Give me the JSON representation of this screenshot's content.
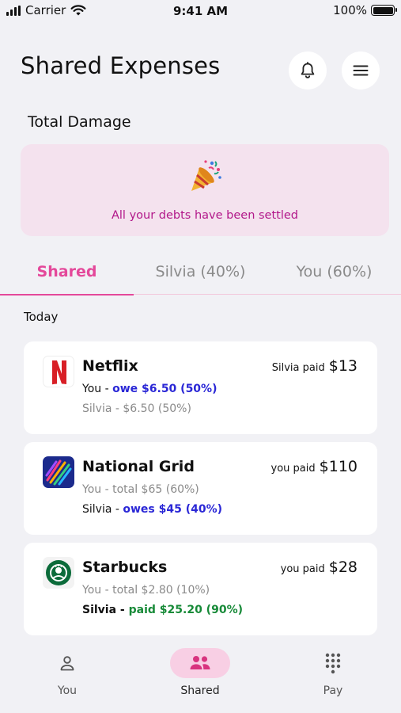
{
  "status_bar": {
    "carrier": "Carrier",
    "time": "9:41 AM",
    "battery": "100%"
  },
  "header": {
    "title": "Shared Expenses"
  },
  "total": {
    "label": "Total Damage",
    "banner_icon": "party-popper-icon",
    "message": "All your debts have been settled"
  },
  "tabs": [
    {
      "label": "Shared",
      "active": true
    },
    {
      "label": "Silvia (40%)",
      "active": false
    },
    {
      "label": "You (60%)",
      "active": false
    }
  ],
  "day_label": "Today",
  "expenses": [
    {
      "merchant": "Netflix",
      "paid_label": "Silvia paid",
      "amount": "$13",
      "line1_prefix": "You - ",
      "line1_value": "owe $6.50 (50%)",
      "line2_prefix": "Silvia - ",
      "line2_value": "$6.50 (50%)"
    },
    {
      "merchant": "National Grid",
      "paid_label": "you paid",
      "amount": "$110",
      "line1_prefix": "You - ",
      "line1_value": "total $65 (60%)",
      "line2_prefix": "Silvia - ",
      "line2_value": "owes $45 (40%)"
    },
    {
      "merchant": "Starbucks",
      "paid_label": "you paid",
      "amount": "$28",
      "line1_prefix": "You - ",
      "line1_value": "total $2.80 (10%)",
      "line2_prefix": "Silvia - ",
      "line2_value": "paid $25.20 (90%)"
    }
  ],
  "nav": [
    {
      "label": "You",
      "icon": "person-icon",
      "active": false
    },
    {
      "label": "Shared",
      "icon": "group-icon",
      "active": true
    },
    {
      "label": "Pay",
      "icon": "keypad-icon",
      "active": false
    }
  ],
  "colors": {
    "accent": "#e4489a",
    "banner_bg": "#f4e2ee",
    "banner_text": "#b2188a",
    "owe_blue": "#2a27d6",
    "paid_green": "#178a38"
  }
}
